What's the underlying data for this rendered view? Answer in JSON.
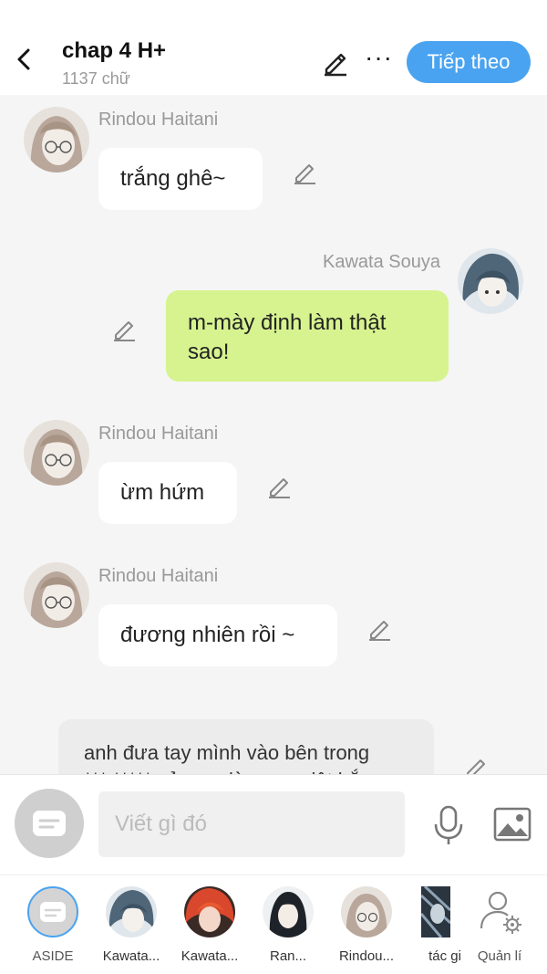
{
  "header": {
    "title": "chap 4 H+",
    "word_count": "1137 chữ",
    "next_label": "Tiếp theo",
    "more_glyph": "···"
  },
  "messages": [
    {
      "sender": "Rindou Haitani",
      "text": "trắng ghê~",
      "side": "left"
    },
    {
      "sender": "Kawata Souya",
      "text_line1": "m-mày định làm thật",
      "text_line2": "sao!",
      "side": "right"
    },
    {
      "sender": "Rindou Haitani",
      "text": "ừm hứm",
      "side": "left"
    },
    {
      "sender": "Rindou Haitani",
      "text": "đương nhiên rồi ~",
      "side": "left"
    },
    {
      "type": "aside",
      "text_line1": "anh đưa tay mình vào bên trong",
      "text_line2": "*** ***** của em làm em giật bắn"
    }
  ],
  "composer": {
    "placeholder": "Viết gì đó"
  },
  "characters": [
    {
      "label": "ASIDE"
    },
    {
      "label": "Kawata..."
    },
    {
      "label": "Kawata..."
    },
    {
      "label": "Ran..."
    },
    {
      "label": "Rindou..."
    },
    {
      "label": "tác gi"
    },
    {
      "label": "Quản lí"
    }
  ],
  "colors": {
    "accent": "#4aa3f0",
    "my_bubble": "#d6f38f",
    "other_bubble": "#ffffff",
    "background": "#f5f5f5"
  }
}
